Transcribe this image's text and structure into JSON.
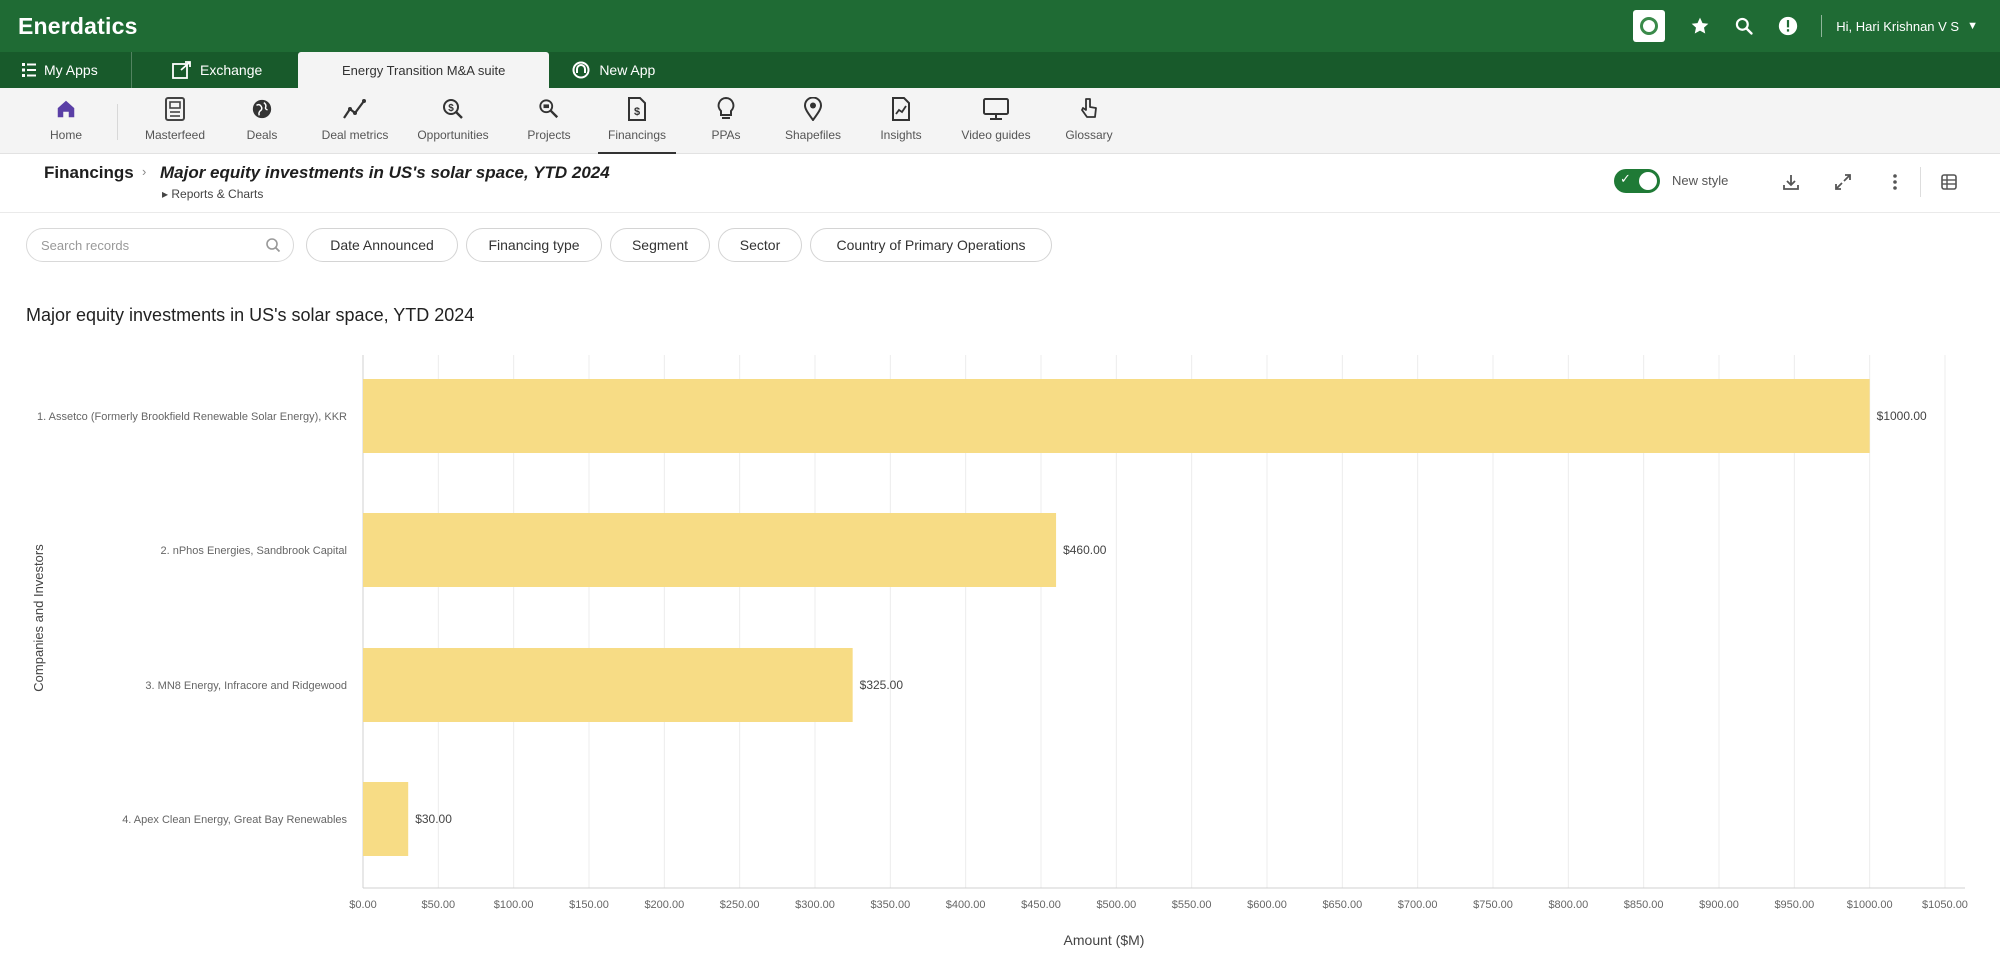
{
  "app": {
    "brand": "Enerdatics"
  },
  "topbar": {
    "user_greeting": "Hi, Hari Krishnan V S"
  },
  "app_tabs": [
    {
      "label": "My Apps",
      "icon": "grid-icon"
    },
    {
      "label": "Exchange",
      "icon": "exchange-icon"
    },
    {
      "label": "Energy Transition M&A suite",
      "active": true
    },
    {
      "label": "New App",
      "icon": "app-icon"
    }
  ],
  "nav": [
    {
      "label": "Home",
      "icon": "home-icon"
    },
    {
      "label": "Masterfeed",
      "icon": "feed-icon"
    },
    {
      "label": "Deals",
      "icon": "globe-icon"
    },
    {
      "label": "Deal metrics",
      "icon": "line-chart-icon"
    },
    {
      "label": "Opportunities",
      "icon": "opportunities-icon"
    },
    {
      "label": "Projects",
      "icon": "projects-icon"
    },
    {
      "label": "Financings",
      "icon": "financings-icon",
      "active": true
    },
    {
      "label": "PPAs",
      "icon": "bulb-icon"
    },
    {
      "label": "Shapefiles",
      "icon": "pin-icon"
    },
    {
      "label": "Insights",
      "icon": "insights-icon"
    },
    {
      "label": "Video guides",
      "icon": "monitor-icon"
    },
    {
      "label": "Glossary",
      "icon": "pointer-icon"
    }
  ],
  "breadcrumb": {
    "root": "Financings",
    "title": "Major equity investments in US's solar space, YTD 2024",
    "sub": "▸ Reports & Charts"
  },
  "view_toggle": {
    "label": "New style",
    "on": true
  },
  "search": {
    "placeholder": "Search records"
  },
  "filters": [
    "Date Announced",
    "Financing type",
    "Segment",
    "Sector",
    "Country of Primary Operations"
  ],
  "colors": {
    "brand": "#1f6b34",
    "bar": "#f7dc85"
  },
  "chart_data": {
    "type": "bar",
    "orientation": "horizontal",
    "title": "Major equity investments in US's solar space, YTD 2024",
    "xlabel": "Amount ($M)",
    "ylabel": "Companies and Investors",
    "xlim": [
      0,
      1050
    ],
    "categories": [
      "1. Assetco (Formerly Brookfield Renewable Solar Energy), KKR",
      "2. nPhos Energies, Sandbrook Capital",
      "3. MN8 Energy, Infracore and Ridgewood",
      "4. Apex Clean Energy, Great Bay Renewables"
    ],
    "values": [
      1000,
      460,
      325,
      30
    ],
    "value_labels": [
      "$1000.00",
      "$460.00",
      "$325.00",
      "$30.00"
    ],
    "x_ticks": [
      "$0.00",
      "$50.00",
      "$100.00",
      "$150.00",
      "$200.00",
      "$250.00",
      "$300.00",
      "$350.00",
      "$400.00",
      "$450.00",
      "$500.00",
      "$550.00",
      "$600.00",
      "$650.00",
      "$700.00",
      "$750.00",
      "$800.00",
      "$850.00",
      "$900.00",
      "$950.00",
      "$1000.00",
      "$1050.00"
    ],
    "grid": true
  }
}
